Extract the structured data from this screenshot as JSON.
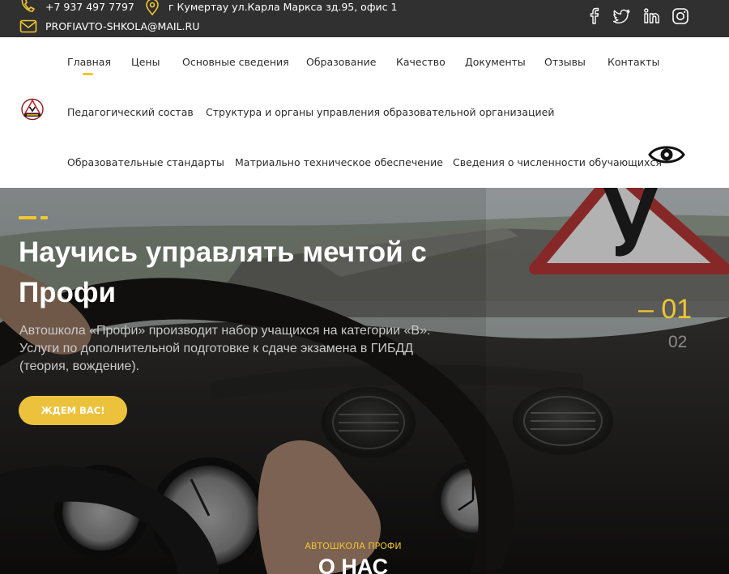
{
  "topbar": {
    "phone": "+7 937 497 7797",
    "address": "г Кумертау ул.Карла Маркса зд.95, офис 1",
    "email": "PROFIAVTO-SHKOLA@MAIL.RU",
    "icons": [
      "phone-icon",
      "location-icon",
      "mail-icon"
    ],
    "social": [
      "facebook-icon",
      "twitter-icon",
      "linkedin-icon",
      "instagram-icon"
    ]
  },
  "nav": {
    "row1": [
      "Главная",
      "Цены",
      "Основные сведения",
      "Образование",
      "Качество",
      "Документы",
      "Отзывы",
      "Контакты"
    ],
    "row2": [
      "Педагогический состав",
      "Структура и органы управления образовательной организацией"
    ],
    "row3": [
      "Образовательные стандарты",
      "Матриально техническое обеспечение",
      "Сведения о численности обучающихся"
    ],
    "active": "Главная",
    "accessibility_icon": "eye-icon"
  },
  "hero": {
    "title": "Научись управлять мечтой с Профи",
    "text": "Автошкола «Профи» производит набор учащихся на категории «В». Услуги по дополнительной подготовке к сдаче экзамена в ГИБДД (теория, вождение).",
    "button": "ЖДЕМ ВАС!",
    "slide_active": "01",
    "slide_next": "02",
    "sign_letter": "У"
  },
  "about": {
    "subtitle": "АВТОШКОЛА ПРОФИ",
    "title": "О НАС"
  },
  "colors": {
    "accent": "#f1c62f",
    "topbar_bg": "#303030",
    "button": "#ecc23c"
  }
}
